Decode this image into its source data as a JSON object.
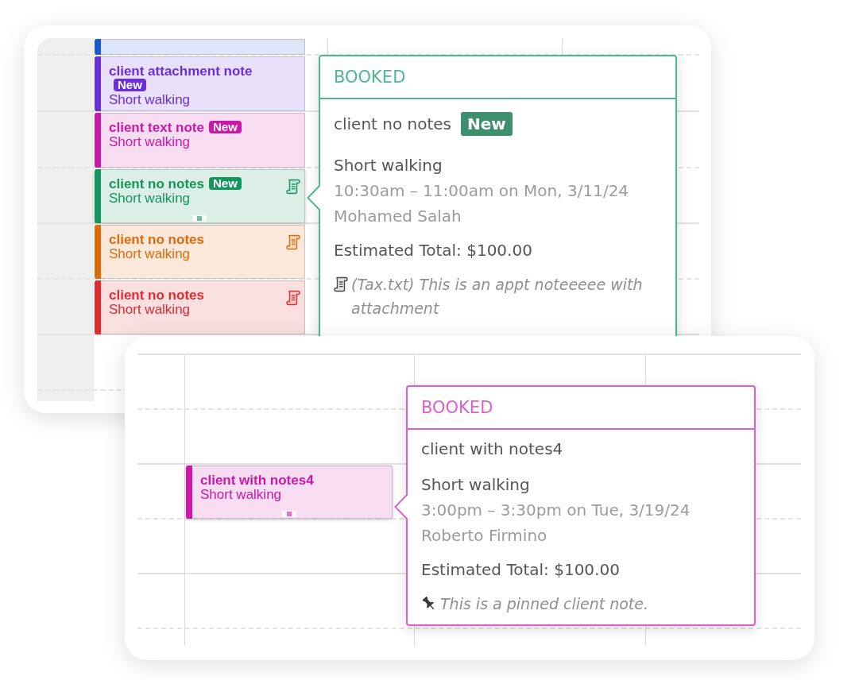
{
  "panels": [
    {
      "appointments": [
        {
          "color": "#1a5ad6",
          "note_icon": false,
          "selected": false
        },
        {
          "client": "client attachment note",
          "badge": "New",
          "service": "Short walking",
          "color": "#6a2ee0",
          "note_icon": false,
          "selected": false
        },
        {
          "client": "client text note",
          "badge": "New",
          "service": "Short walking",
          "color": "#cc17a8",
          "note_icon": false,
          "selected": false
        },
        {
          "client": "client no notes",
          "badge": "New",
          "service": "Short walking",
          "color": "#149560",
          "note_icon": true,
          "selected": true
        },
        {
          "client": "client no notes",
          "service": "Short walking",
          "color": "#e06a0a",
          "note_icon": true,
          "selected": false
        },
        {
          "client": "client no notes",
          "service": "Short walking",
          "color": "#e02c30",
          "note_icon": true,
          "selected": false
        }
      ],
      "popover": {
        "status": "BOOKED",
        "color": "#4db88f",
        "client": "client no notes",
        "badge": "New",
        "service": "Short walking",
        "time": "10:30am – 11:00am on Mon, 3/11/24",
        "staff": "Mohamed Salah",
        "total": "Estimated Total: $100.00",
        "note": {
          "kind": "attachment",
          "text": "(Tax.txt) This is an appt noteeeee with attachment"
        }
      }
    },
    {
      "appointments": [
        {
          "client": "client with notes4",
          "service": "Short walking",
          "color": "#cc17a8",
          "note_icon": false,
          "selected": true
        }
      ],
      "popover": {
        "status": "BOOKED",
        "color": "#dc5fd0",
        "client": "client with notes4",
        "service": "Short walking",
        "time": "3:00pm – 3:30pm on Tue, 3/19/24",
        "staff": "Roberto Firmino",
        "total": "Estimated Total: $100.00",
        "note": {
          "kind": "pinned",
          "text": "This is a pinned client note."
        }
      }
    }
  ]
}
